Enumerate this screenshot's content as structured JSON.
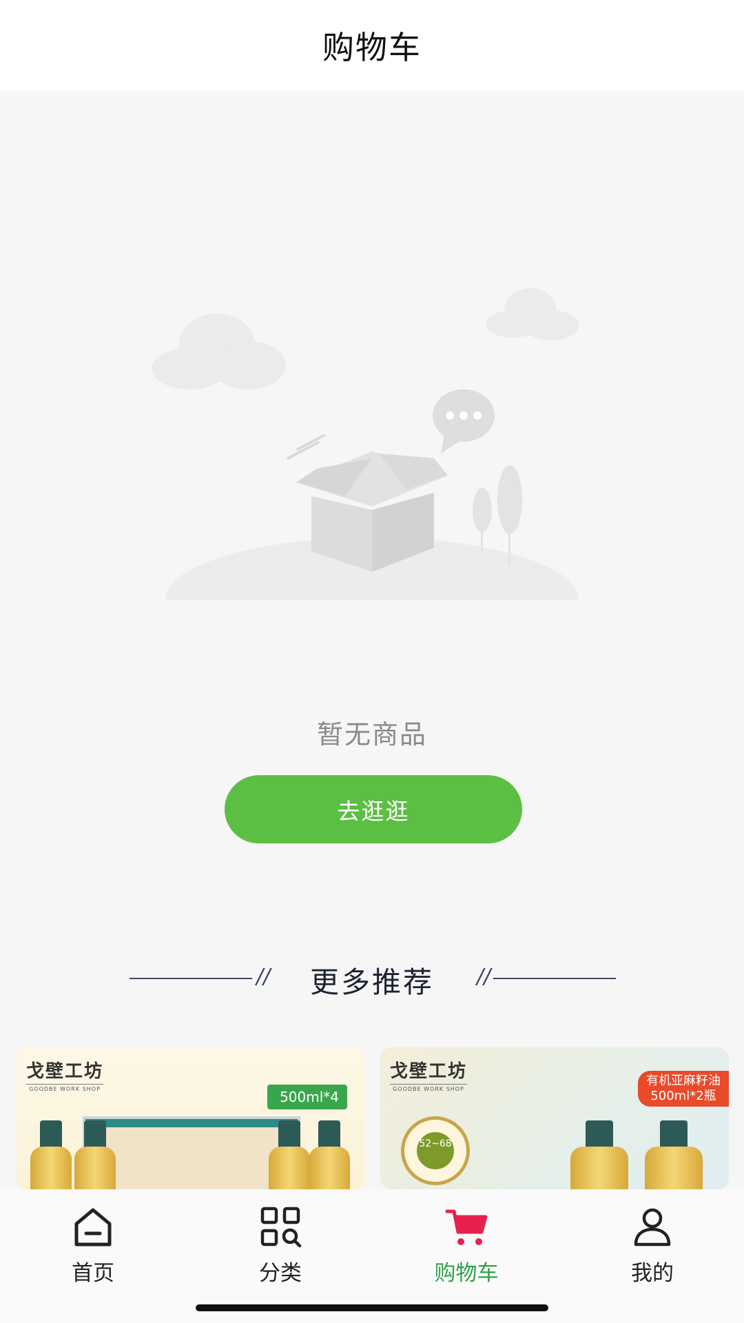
{
  "header": {
    "title": "购物车"
  },
  "empty": {
    "message": "暂无商品",
    "button_label": "去逛逛"
  },
  "recommend": {
    "title": "更多推荐"
  },
  "products": [
    {
      "brand_cn": "戈壁工坊",
      "brand_en": "GOODBE WORK SHOP",
      "tag": "500ml*4"
    },
    {
      "brand_cn": "戈壁工坊",
      "brand_en": "GOODBE WORK SHOP",
      "tag_line1": "有机亚麻籽油",
      "tag_line2": "500ml*2瓶",
      "badge": "52~68"
    }
  ],
  "tabbar": {
    "items": [
      {
        "label": "首页",
        "icon": "home-icon"
      },
      {
        "label": "分类",
        "icon": "category-search-icon"
      },
      {
        "label": "购物车",
        "icon": "cart-icon"
      },
      {
        "label": "我的",
        "icon": "user-icon"
      }
    ],
    "active_index": 2,
    "active_color": "#2fa24a",
    "cart_icon_color": "#e8204e"
  },
  "colors": {
    "accent_button": "#5bbf43",
    "background": "#f6f6f6"
  }
}
